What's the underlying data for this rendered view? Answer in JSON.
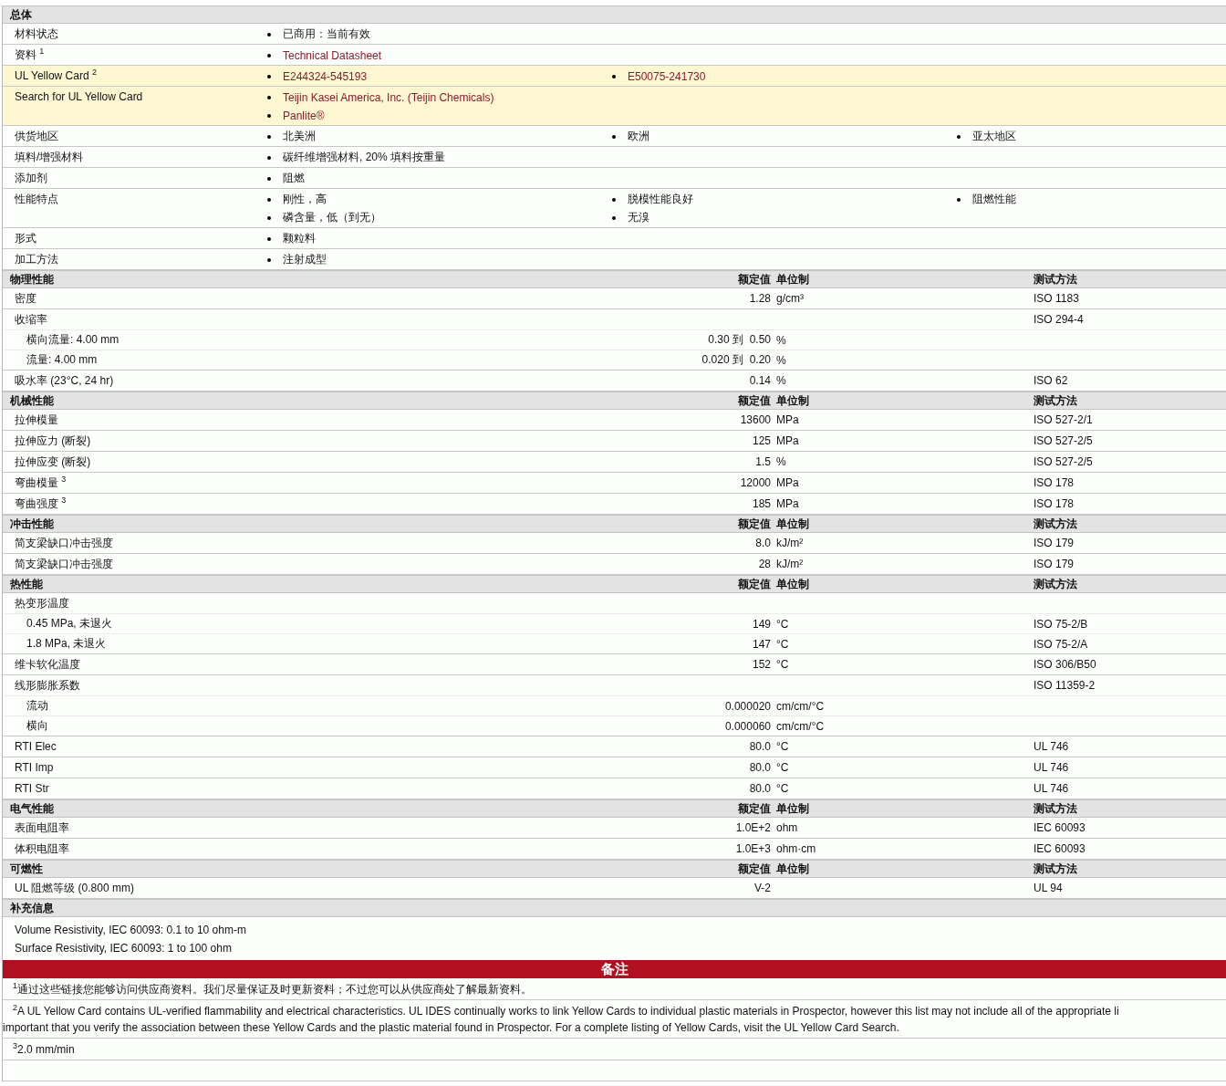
{
  "general": {
    "title": "总体",
    "rows": [
      {
        "label": "材料状态",
        "highlighted": false,
        "link": false,
        "columns": [
          [
            "已商用：当前有效"
          ]
        ]
      },
      {
        "label": "资料 $^{1}$",
        "highlighted": false,
        "link": true,
        "columns": [
          [
            "Technical Datasheet"
          ]
        ]
      },
      {
        "label": "UL Yellow Card $^{2}$",
        "highlighted": true,
        "link": true,
        "columns": [
          [
            "E244324-545193"
          ],
          [
            "E50075-241730"
          ]
        ]
      },
      {
        "label": "Search for UL Yellow Card",
        "highlighted": true,
        "link": true,
        "columns": [
          [
            "Teijin Kasei America, Inc. (Teijin Chemicals)",
            "Panlite®"
          ]
        ]
      },
      {
        "label": "供货地区",
        "highlighted": false,
        "link": false,
        "columns": [
          [
            "北美洲"
          ],
          [
            "欧洲"
          ],
          [
            "亚太地区"
          ]
        ]
      },
      {
        "label": "填料/增强材料",
        "highlighted": false,
        "link": false,
        "columns": [
          [
            "碳纤维增强材料, 20% 填料按重量"
          ]
        ]
      },
      {
        "label": "添加剂",
        "highlighted": false,
        "link": false,
        "columns": [
          [
            "阻燃"
          ]
        ]
      },
      {
        "label": "性能特点",
        "highlighted": false,
        "link": false,
        "columns": [
          [
            "刚性，高",
            "磷含量，低（到无）"
          ],
          [
            "脱模性能良好",
            "无溴"
          ],
          [
            "阻燃性能"
          ]
        ]
      },
      {
        "label": "形式",
        "highlighted": false,
        "link": false,
        "columns": [
          [
            "颗粒料"
          ]
        ]
      },
      {
        "label": "加工方法",
        "highlighted": false,
        "link": false,
        "columns": [
          [
            "注射成型"
          ]
        ]
      }
    ]
  },
  "property_sections": [
    {
      "title": "物理性能",
      "value_header": "额定值",
      "unit_header": "单位制",
      "method_header": "测试方法",
      "rows": [
        {
          "name": "密度",
          "value": "1.28",
          "unit": "g/cm³",
          "method": "ISO 1183"
        },
        {
          "name": "收缩率",
          "method": "ISO 294-4",
          "children": [
            {
              "name": "横向流量: 4.00 mm",
              "value": "0.30 到  0.50",
              "unit": "%"
            },
            {
              "name": "流量: 4.00 mm",
              "value": "0.020 到  0.20",
              "unit": "%"
            }
          ]
        },
        {
          "name": "吸水率  (23°C, 24 hr)",
          "value": "0.14",
          "unit": "%",
          "method": "ISO 62"
        }
      ]
    },
    {
      "title": "机械性能",
      "value_header": "额定值",
      "unit_header": "单位制",
      "method_header": "测试方法",
      "rows": [
        {
          "name": "拉伸模量",
          "value": "13600",
          "unit": "MPa",
          "method": "ISO 527-2/1"
        },
        {
          "name": "拉伸应力  (断裂)",
          "value": "125",
          "unit": "MPa",
          "method": "ISO 527-2/5"
        },
        {
          "name": "拉伸应变  (断裂)",
          "value": "1.5",
          "unit": "%",
          "method": "ISO 527-2/5"
        },
        {
          "name": "弯曲模量 $^{3}$",
          "value": "12000",
          "unit": "MPa",
          "method": "ISO 178"
        },
        {
          "name": "弯曲强度 $^{3}$",
          "value": "185",
          "unit": "MPa",
          "method": "ISO 178"
        }
      ]
    },
    {
      "title": "冲击性能",
      "value_header": "额定值",
      "unit_header": "单位制",
      "method_header": "测试方法",
      "rows": [
        {
          "name": "简支梁缺口冲击强度",
          "value": "8.0",
          "unit": "kJ/m²",
          "method": "ISO 179"
        },
        {
          "name": "简支梁缺口冲击强度",
          "value": "28",
          "unit": "kJ/m²",
          "method": "ISO 179"
        }
      ]
    },
    {
      "title": "热性能",
      "value_header": "额定值",
      "unit_header": "单位制",
      "method_header": "测试方法",
      "rows": [
        {
          "name": "热变形温度",
          "children": [
            {
              "name": "0.45 MPa, 未退火",
              "value": "149",
              "unit": "°C",
              "method": "ISO 75-2/B"
            },
            {
              "name": "1.8 MPa, 未退火",
              "value": "147",
              "unit": "°C",
              "method": "ISO 75-2/A"
            }
          ]
        },
        {
          "name": "维卡软化温度",
          "value": "152",
          "unit": "°C",
          "method": "ISO 306/B50"
        },
        {
          "name": "线形膨胀系数",
          "method": "ISO 11359-2",
          "children": [
            {
              "name": "流动",
              "value": "0.000020",
              "unit": "cm/cm/°C"
            },
            {
              "name": "横向",
              "value": "0.000060",
              "unit": "cm/cm/°C"
            }
          ]
        },
        {
          "name": "RTI Elec",
          "value": "80.0",
          "unit": "°C",
          "method": "UL 746"
        },
        {
          "name": "RTI Imp",
          "value": "80.0",
          "unit": "°C",
          "method": "UL 746"
        },
        {
          "name": "RTI Str",
          "value": "80.0",
          "unit": "°C",
          "method": "UL 746"
        }
      ]
    },
    {
      "title": "电气性能",
      "value_header": "额定值",
      "unit_header": "单位制",
      "method_header": "测试方法",
      "rows": [
        {
          "name": "表面电阻率",
          "value": "1.0E+2",
          "unit": "ohm",
          "method": "IEC 60093"
        },
        {
          "name": "体积电阻率",
          "value": "1.0E+3",
          "unit": "ohm·cm",
          "method": "IEC 60093"
        }
      ]
    },
    {
      "title": "可燃性",
      "value_header": "额定值",
      "unit_header": "单位制",
      "method_header": "测试方法",
      "rows": [
        {
          "name": "UL 阻燃等级  (0.800 mm)",
          "value": "V-2",
          "method": "UL 94"
        }
      ]
    }
  ],
  "supplementary": {
    "title": "补充信息",
    "lines": [
      "Volume Resistivity, IEC 60093: 0.1 to 10 ohm-m",
      "Surface Resistivity, IEC 60093: 1 to 100 ohm"
    ]
  },
  "notes": {
    "title": "备注",
    "items": [
      {
        "mark": "1",
        "lines": [
          "通过这些链接您能够访问供应商资料。我们尽量保证及时更新资料；不过您可以从供应商处了解最新资料。"
        ]
      },
      {
        "mark": "2",
        "lines": [
          "A UL Yellow Card contains UL-verified flammability and electrical characteristics. UL IDES continually works to link Yellow Cards to individual plastic materials in Prospector, however this list may not include all of the appropriate li",
          "important that you verify the association between these Yellow Cards and the plastic material found in Prospector. For a complete listing of Yellow Cards, visit the UL Yellow Card Search."
        ]
      },
      {
        "mark": "3",
        "lines": [
          "2.0 mm/min"
        ]
      }
    ]
  }
}
